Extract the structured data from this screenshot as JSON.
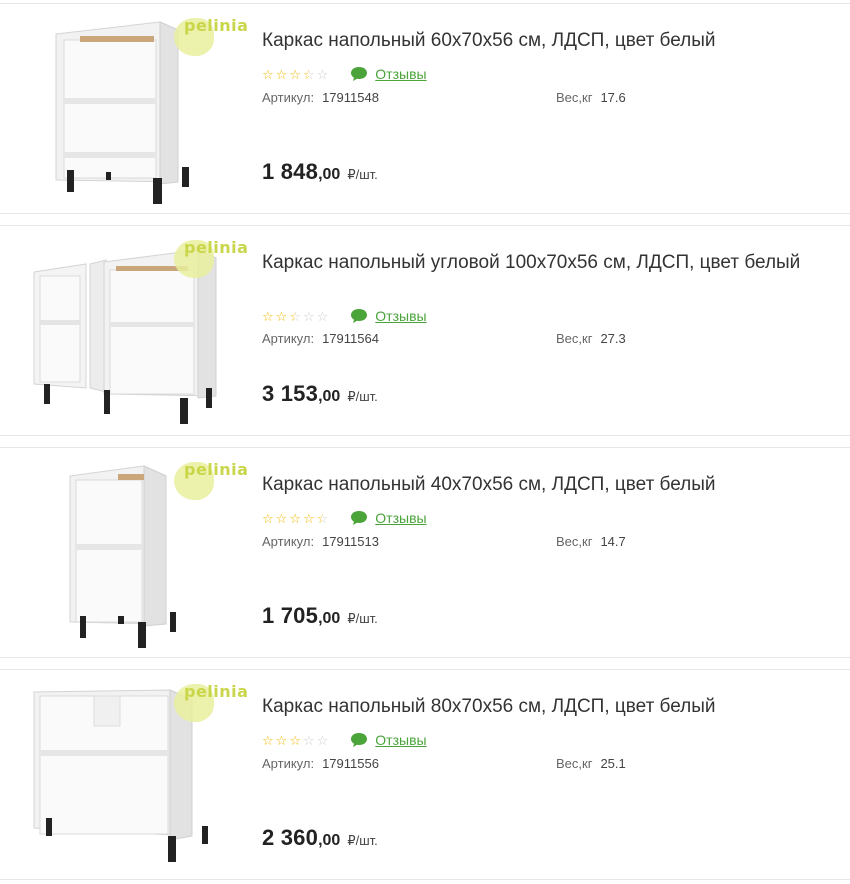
{
  "brand": "pelinia",
  "colors": {
    "star": "#f2b700",
    "star_empty": "#cfcfcf",
    "reviews": "#4aa43a",
    "brand": "#c9d64a"
  },
  "icons": {
    "review": "speech-bubble-icon",
    "star": "star-icon"
  },
  "products": [
    {
      "title": "Каркас напольный 60х70х56 см, ЛДСП, цвет белый",
      "rating": 3.5,
      "reviews_label": "Отзывы",
      "sku_label": "Артикул:",
      "sku": "17911548",
      "weight_label": "Вес,кг",
      "weight": "17.6",
      "price_int": "1 848",
      "price_dec": ",00",
      "price_unit": "₽/шт.",
      "image": "cabinet-60"
    },
    {
      "title": "Каркас напольный угловой 100х70х56 см, ЛДСП, цвет белый",
      "rating": 2.5,
      "reviews_label": "Отзывы",
      "sku_label": "Артикул:",
      "sku": "17911564",
      "weight_label": "Вес,кг",
      "weight": "27.3",
      "price_int": "3 153",
      "price_dec": ",00",
      "price_unit": "₽/шт.",
      "image": "cabinet-corner-100"
    },
    {
      "title": "Каркас напольный 40х70х56 см, ЛДСП, цвет белый",
      "rating": 4.5,
      "reviews_label": "Отзывы",
      "sku_label": "Артикул:",
      "sku": "17911513",
      "weight_label": "Вес,кг",
      "weight": "14.7",
      "price_int": "1 705",
      "price_dec": ",00",
      "price_unit": "₽/шт.",
      "image": "cabinet-40"
    },
    {
      "title": "Каркас напольный 80х70х56 см, ЛДСП, цвет белый",
      "rating": 3,
      "reviews_label": "Отзывы",
      "sku_label": "Артикул:",
      "sku": "17911556",
      "weight_label": "Вес,кг",
      "weight": "25.1",
      "price_int": "2 360",
      "price_dec": ",00",
      "price_unit": "₽/шт.",
      "image": "cabinet-80"
    }
  ]
}
